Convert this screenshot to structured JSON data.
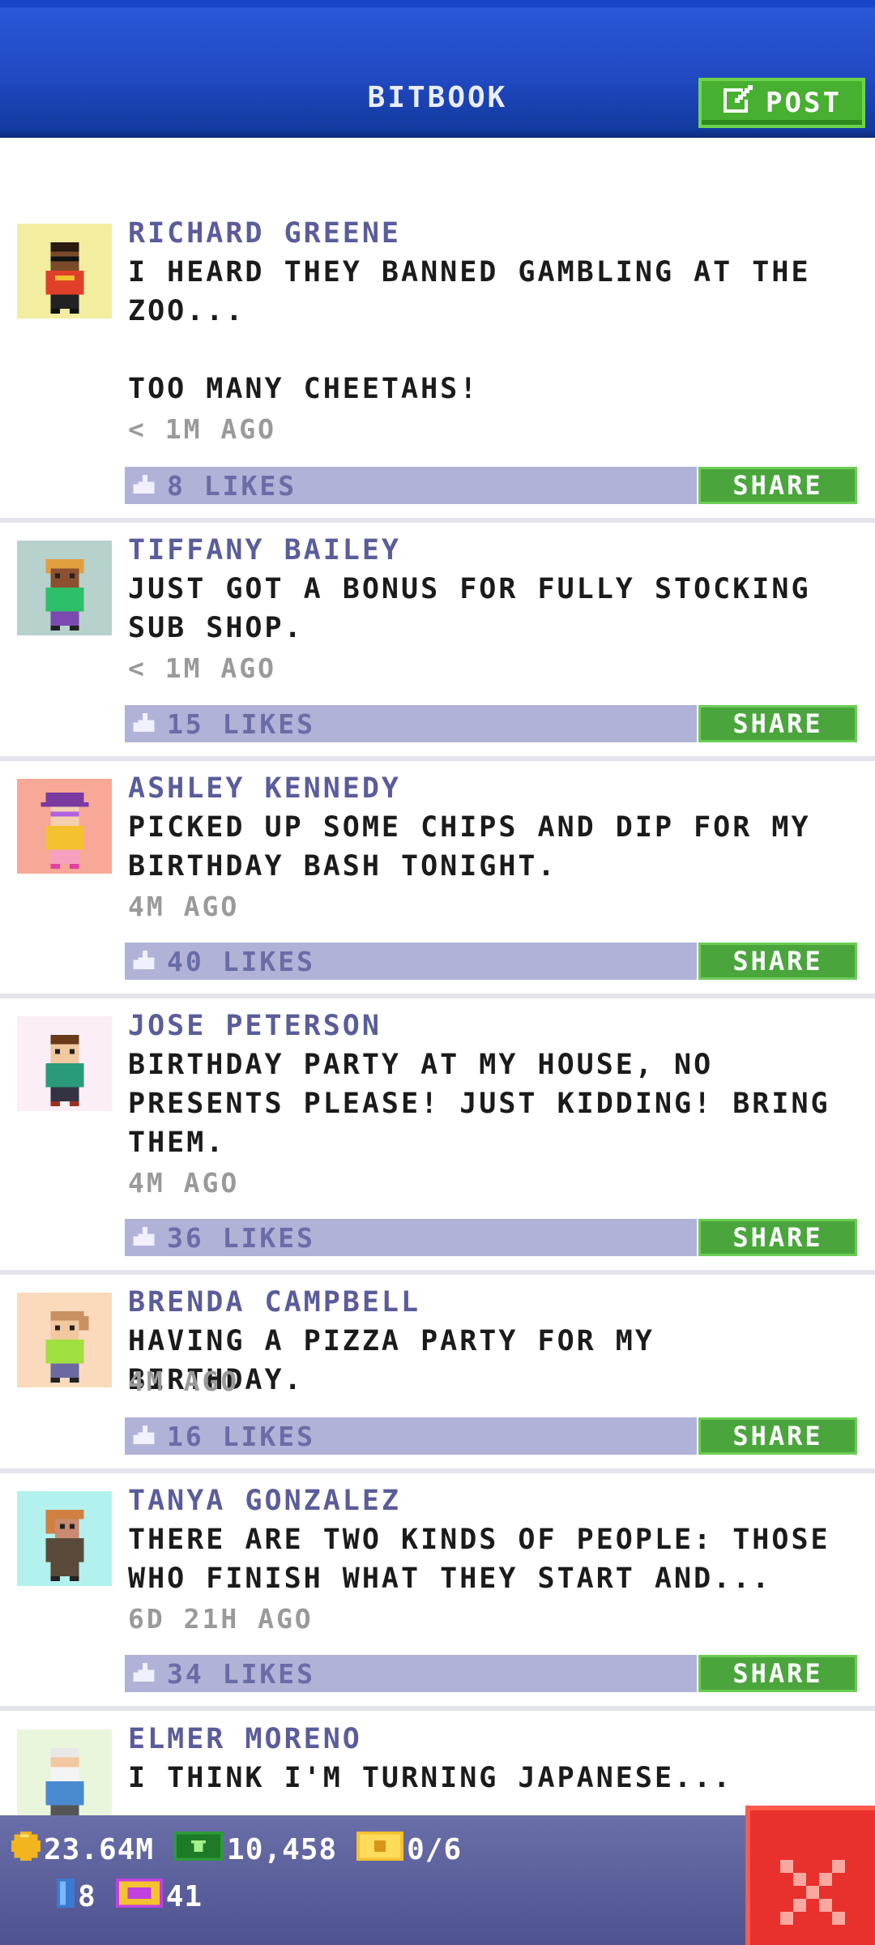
{
  "header": {
    "title": "BITBOOK",
    "post_label": "POST"
  },
  "posts": [
    {
      "author": "RICHARD GREENE",
      "text": "I HEARD THEY BANNED GAMBLING AT THE\nZOO...\n\nTOO MANY CHEETAHS!",
      "time": "< 1M AGO",
      "likes": "8 LIKES",
      "share": "SHARE",
      "avatar_bg": "#f3eda0"
    },
    {
      "author": "TIFFANY BAILEY",
      "text": "JUST GOT A BONUS FOR FULLY STOCKING\nSUB SHOP.",
      "time": "< 1M AGO",
      "likes": "15 LIKES",
      "share": "SHARE",
      "avatar_bg": "#b7d1cd"
    },
    {
      "author": "ASHLEY KENNEDY",
      "text": "PICKED UP SOME CHIPS AND DIP FOR MY\nBIRTHDAY BASH TONIGHT.",
      "time": "4M AGO",
      "likes": "40 LIKES",
      "share": "SHARE",
      "avatar_bg": "#f7a896"
    },
    {
      "author": "JOSE PETERSON",
      "text": "BIRTHDAY PARTY AT MY HOUSE, NO\nPRESENTS PLEASE! JUST KIDDING! BRING\nTHEM.",
      "time": "4M AGO",
      "likes": "36 LIKES",
      "share": "SHARE",
      "avatar_bg": "#fbeef7"
    },
    {
      "author": "BRENDA CAMPBELL",
      "text": "HAVING A PIZZA PARTY FOR MY BIRTHDAY.",
      "time": "4M AGO",
      "likes": "16 LIKES",
      "share": "SHARE",
      "avatar_bg": "#fbd9bd"
    },
    {
      "author": "TANYA GONZALEZ",
      "text": "THERE ARE TWO KINDS OF PEOPLE: THOSE\nWHO FINISH WHAT THEY START AND...",
      "time": "6D 21H AGO",
      "likes": "34 LIKES",
      "share": "SHARE",
      "avatar_bg": "#b3f1ee"
    },
    {
      "author": "ELMER MORENO",
      "text": "I THINK I'M TURNING JAPANESE...",
      "time": "",
      "likes": "",
      "share": "",
      "avatar_bg": "#e9f6dc"
    }
  ],
  "status_bar": {
    "coins": "23.64M",
    "bux": "10,458",
    "tickets": "0/6",
    "keys": "8",
    "vip": "41"
  },
  "icons": {
    "post": "edit-icon",
    "like": "thumbs-up-icon",
    "coin": "coin-icon",
    "bux": "bux-icon",
    "ticket": "ticket-icon",
    "key": "key-icon",
    "vip": "vip-icon",
    "close": "close-icon"
  },
  "colors": {
    "header": "#1f47bf",
    "share": "#4aa63c",
    "likes_bar": "#b0b2d8",
    "author": "#5b5c9b",
    "close": "#e8302c"
  }
}
